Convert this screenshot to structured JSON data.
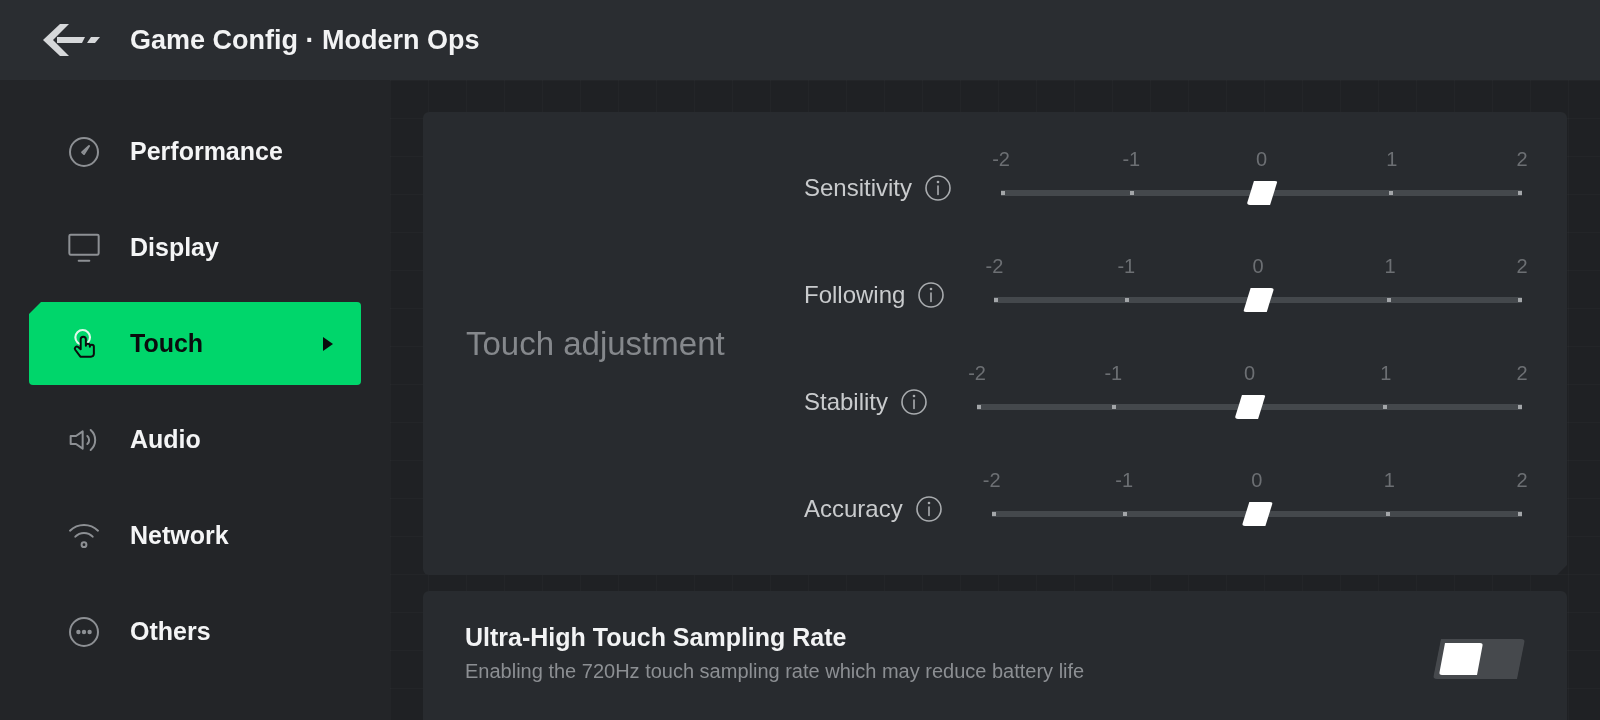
{
  "header": {
    "title": "Game Config · Modern Ops"
  },
  "sidebar": {
    "items": [
      {
        "label": "Performance",
        "selected": false
      },
      {
        "label": "Display",
        "selected": false
      },
      {
        "label": "Touch",
        "selected": true
      },
      {
        "label": "Audio",
        "selected": false
      },
      {
        "label": "Network",
        "selected": false
      },
      {
        "label": "Others",
        "selected": false
      }
    ]
  },
  "touch_adjustment": {
    "title": "Touch adjustment",
    "sliders": [
      {
        "label": "Sensitivity",
        "ticks": [
          "-2",
          "-1",
          "0",
          "1",
          "2"
        ],
        "level": 0.5
      },
      {
        "label": "Following",
        "ticks": [
          "-2",
          "-1",
          "0",
          "1",
          "2"
        ],
        "level": 0.5
      },
      {
        "label": "Stability",
        "ticks": [
          "-2",
          "-1",
          "0",
          "1",
          "2"
        ],
        "level": 0.5
      },
      {
        "label": "Accuracy",
        "ticks": [
          "-2",
          "-1",
          "0",
          "1",
          "2"
        ],
        "level": 0.5
      }
    ]
  },
  "sampling_rate": {
    "title": "Ultra-High Touch Sampling Rate",
    "description": "Enabling the 720Hz touch sampling rate which may reduce battery life",
    "on": false
  }
}
